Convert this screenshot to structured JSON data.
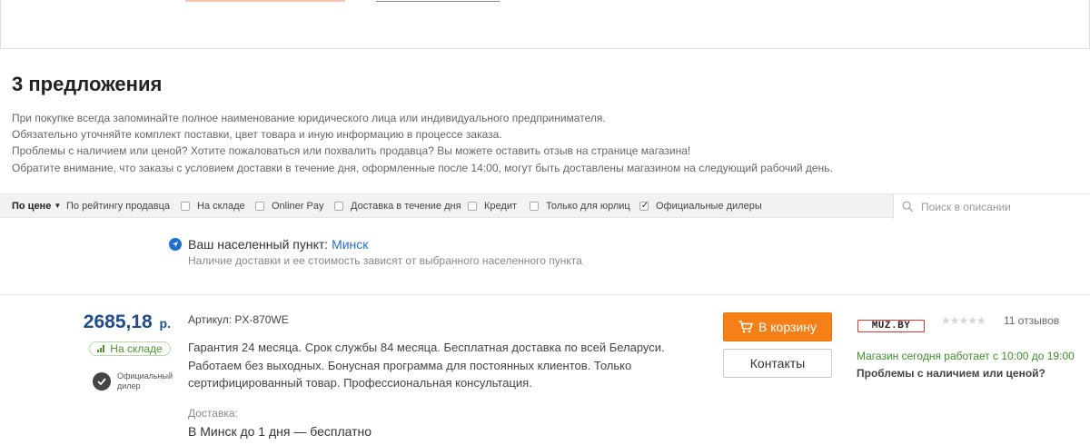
{
  "offers": {
    "title": "3 предложения",
    "notes": [
      "При покупке всегда запоминайте полное наименование юридического лица или индивидуального предпринимателя.",
      "Обязательно уточняйте комплект поставки, цвет товара и иную информацию в процессе заказа.",
      "Проблемы с наличием или ценой? Хотите пожаловаться или похвалить продавца? Вы можете оставить отзыв на странице магазина!",
      "Обратите внимание, что заказы с условием доставки в течение дня, оформленные после 14:00, могут быть доставлены магазином на следующий рабочий день."
    ]
  },
  "filters": {
    "sort_price": "По цене",
    "sort_rating": "По рейтингу продавца",
    "checkboxes": [
      {
        "label": "На складе",
        "checked": false
      },
      {
        "label": "Onliner Pay",
        "checked": false
      },
      {
        "label": "Доставка в течение дня",
        "checked": false
      },
      {
        "label": "Кредит",
        "checked": false
      },
      {
        "label": "Только для юрлиц",
        "checked": false
      },
      {
        "label": "Официальные дилеры",
        "checked": true
      }
    ],
    "search_placeholder": "Поиск в описании"
  },
  "location": {
    "label": "Ваш населенный пункт:",
    "city": "Минск",
    "hint": "Наличие доставки и ее стоимость зависят от выбранного населенного пункта"
  },
  "offer": {
    "price": "2685,18",
    "currency": "р.",
    "stock": "На складе",
    "dealer_line1": "Официальный",
    "dealer_line2": "дилер",
    "article": "Артикул: PX-870WE",
    "description": "Гарантия 24 месяца. Срок службы 84 месяца. Бесплатная доставка по всей Беларуси. Работаем без выходных. Бонусная программа для постоянных клиентов. Только сертифицированный товар. Профессиональная консультация.",
    "delivery_label": "Доставка:",
    "delivery_value": "В Минск до 1 дня — бесплатно",
    "cart_button": "В корзину",
    "contacts_button": "Контакты",
    "shop_logo": "MUZ.BY",
    "rating_stars": "★★★★★",
    "reviews": "11 отзывов",
    "hours": "Магазин сегодня работает с 10:00 до 19:00",
    "problems": "Проблемы с наличием или ценой?"
  },
  "colors": {
    "accent_orange": "#f58017",
    "price_blue": "#1f4d8c",
    "link_blue": "#1f6fd1",
    "stock_green": "#4a9a2a"
  }
}
